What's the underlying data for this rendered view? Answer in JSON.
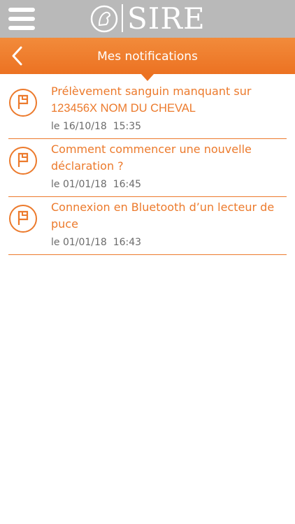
{
  "app": {
    "logo_text": "SIRE"
  },
  "header": {
    "title": "Mes notifications"
  },
  "colors": {
    "accent": "#ec7a2c",
    "topbar": "#b9b9b9",
    "date_text": "#6b6b6b"
  },
  "icons": {
    "menu": "hamburger-menu-icon",
    "back": "chevron-left-icon",
    "notification": "flag-icon",
    "logo": "horse-head-icon"
  },
  "notifications": [
    {
      "title_line1": "Prélèvement sanguin manquant sur",
      "title_line2": "123456X NOM DU CHEVAL",
      "date": "le 16/10/18  15:35"
    },
    {
      "title_line1": "Comment commencer une nouvelle",
      "title_line2": "déclaration ?",
      "date": "le 01/01/18  16:45"
    },
    {
      "title_line1": "Connexion en Bluetooth d’un lecteur de",
      "title_line2": "puce",
      "date": "le 01/01/18  16:43"
    }
  ]
}
